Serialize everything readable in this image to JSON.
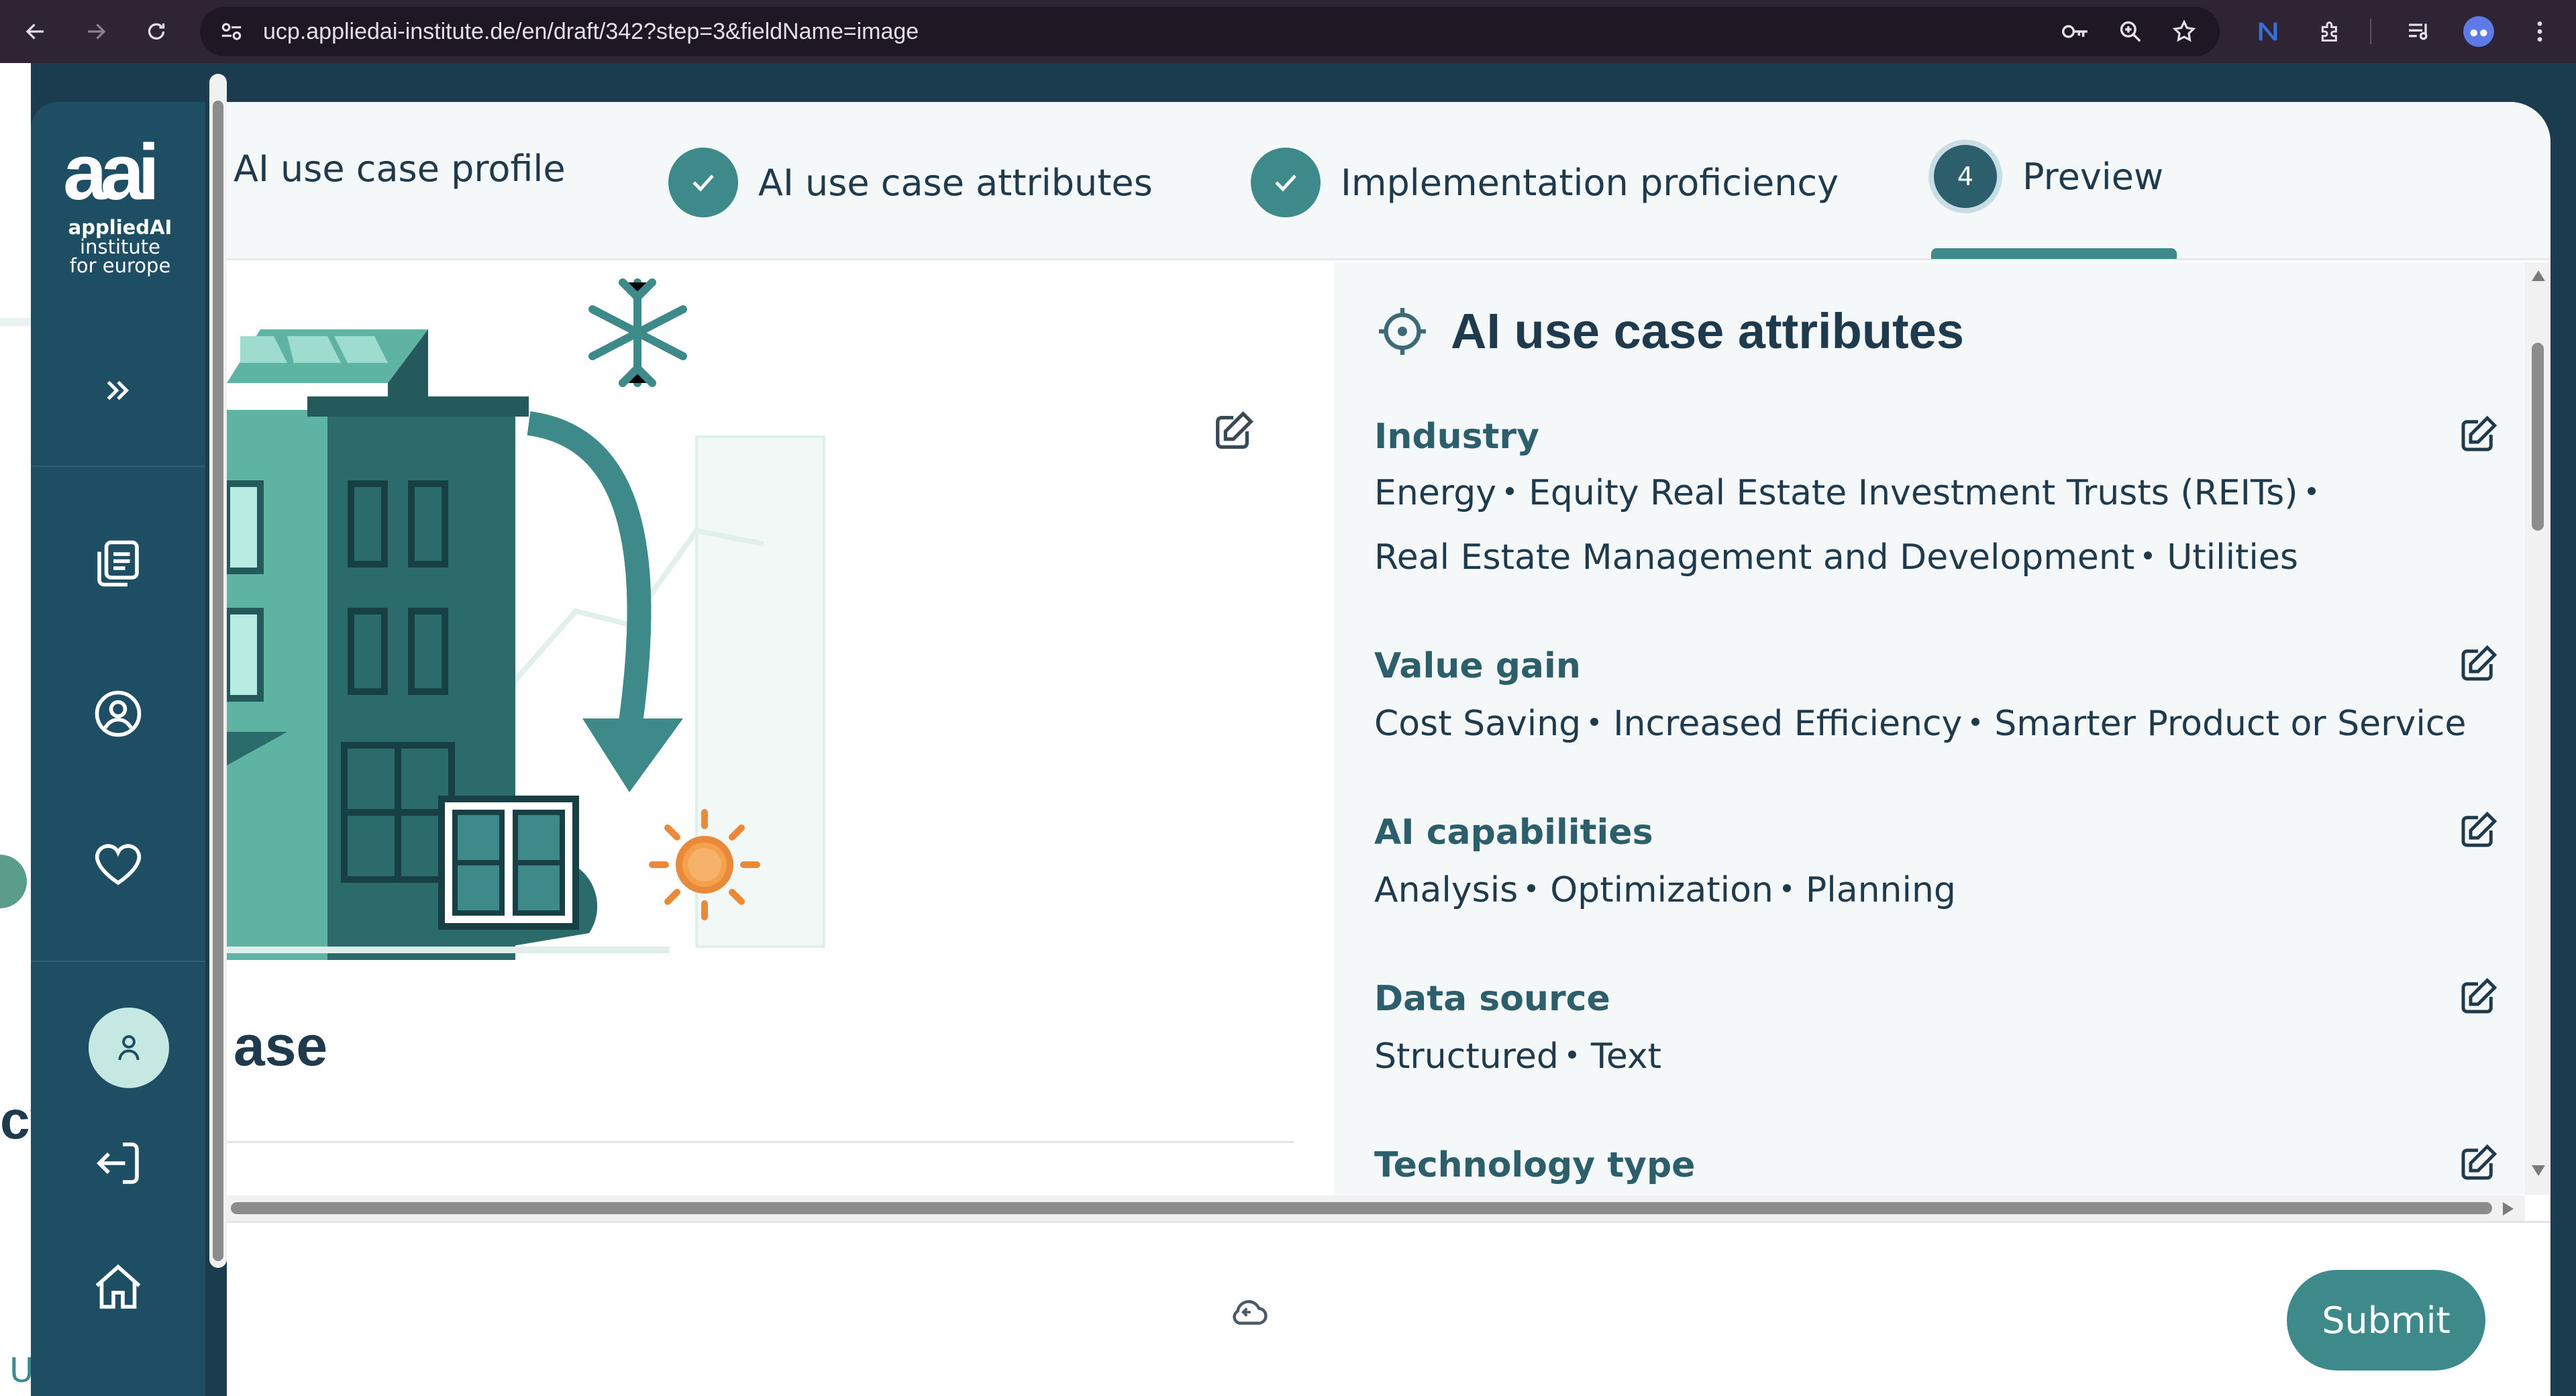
{
  "browser": {
    "url": "ucp.appliedai-institute.de/en/draft/342?step=3&fieldName=image"
  },
  "logo": {
    "mark": "aai",
    "line1": "appliedAI",
    "line2": "institute",
    "line3": "for europe"
  },
  "stepper": {
    "steps": [
      {
        "label": "AI use case profile"
      },
      {
        "label": "AI use case attributes"
      },
      {
        "label": "Implementation proficiency"
      },
      {
        "number": "4",
        "label": "Preview"
      }
    ]
  },
  "left": {
    "title": "ase",
    "left_text": "cy",
    "left_bottom_text": "U"
  },
  "attributes": {
    "title": "AI use case attributes",
    "sections": [
      {
        "title": "Industry",
        "items": [
          "Energy",
          "Equity Real Estate Investment Trusts (REITs)",
          "Real Estate Management and Development",
          "Utilities"
        ]
      },
      {
        "title": "Value gain",
        "items": [
          "Cost Saving",
          "Increased Efficiency",
          "Smarter Product or Service"
        ]
      },
      {
        "title": "AI capabilities",
        "items": [
          "Analysis",
          "Optimization",
          "Planning"
        ]
      },
      {
        "title": "Data source",
        "items": [
          "Structured",
          "Text"
        ]
      },
      {
        "title": "Technology type",
        "items": []
      }
    ]
  },
  "footer": {
    "submit_label": "Submit"
  },
  "colors": {
    "accent": "#3e8a8a",
    "sidebar": "#1e4e63",
    "text": "#1f3a4d"
  }
}
